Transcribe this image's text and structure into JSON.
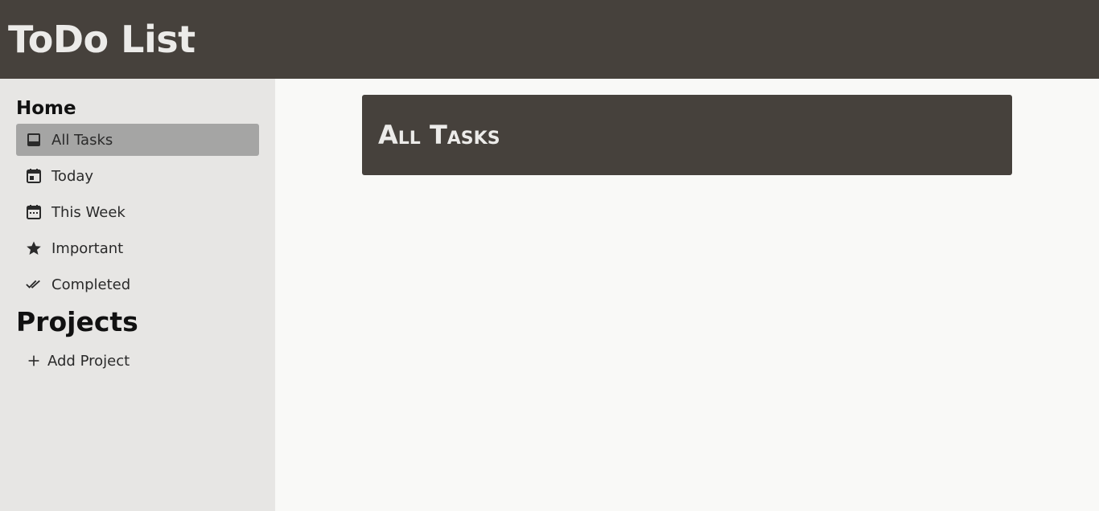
{
  "app": {
    "title": "ToDo List"
  },
  "sidebar": {
    "home_heading": "Home",
    "items": [
      {
        "label": "All Tasks",
        "icon": "inbox-icon",
        "active": true
      },
      {
        "label": "Today",
        "icon": "calendar-today-icon",
        "active": false
      },
      {
        "label": "This Week",
        "icon": "calendar-week-icon",
        "active": false
      },
      {
        "label": "Important",
        "icon": "star-icon",
        "active": false
      },
      {
        "label": "Completed",
        "icon": "double-check-icon",
        "active": false
      }
    ],
    "projects_heading": "Projects",
    "add_project_label": "Add Project",
    "add_project_icon": "plus-icon"
  },
  "main": {
    "heading": "All Tasks"
  },
  "colors": {
    "header_bg": "#46413c",
    "sidebar_bg": "#e7e6e4",
    "active_item_bg": "#a5a5a4",
    "main_bg": "#f9f9f7",
    "header_text": "#ecebe9"
  }
}
